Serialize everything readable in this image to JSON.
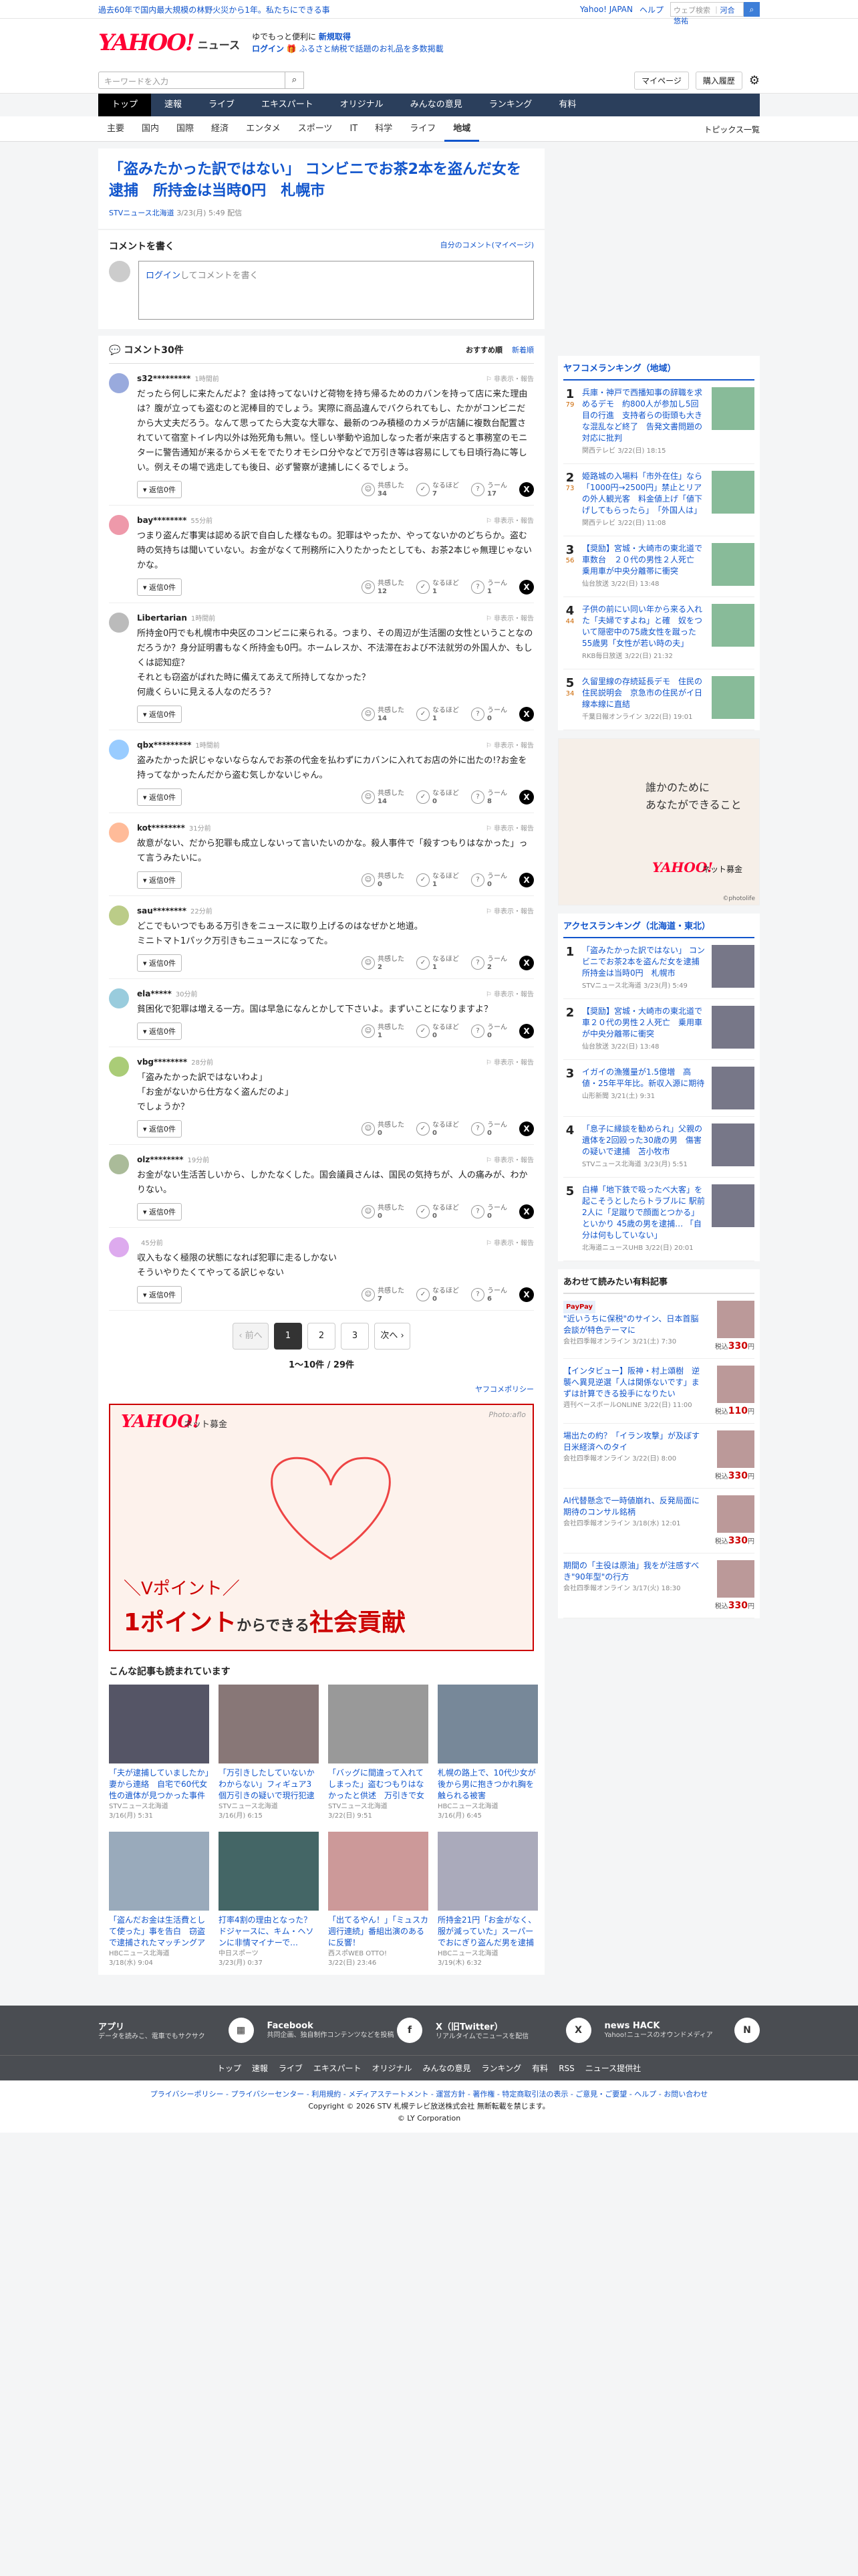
{
  "top": {
    "notice": "過去60年で国内最大規模の林野火災から1年。私たちにできる事",
    "links": [
      "Yahoo! JAPAN",
      "ヘルプ"
    ],
    "search_ph": "ウェブ検索",
    "search_tag": "河合悠祐"
  },
  "header": {
    "brand": "YAHOO!",
    "brand_sub": "JAPAN",
    "service": "ニュース",
    "promo1": "ゆでもっと便利に",
    "promo1b": "新規取得",
    "promo2": "ログイン",
    "promo2b": "ふるさと納税で話題のお礼品を多数掲載"
  },
  "subbar": {
    "search_ph": "キーワードを入力",
    "mypage": "マイページ",
    "purchase": "購入履歴"
  },
  "gnav": [
    "トップ",
    "速報",
    "ライブ",
    "エキスパート",
    "オリジナル",
    "みんなの意見",
    "ランキング",
    "有料"
  ],
  "cnav": [
    "主要",
    "国内",
    "国際",
    "経済",
    "エンタメ",
    "スポーツ",
    "IT",
    "科学",
    "ライフ",
    "地域"
  ],
  "cnav_right": "トピックス一覧",
  "article": {
    "title": "「盗みたかった訳ではない」 コンビニでお茶2本を盗んだ女を逮捕　所持金は当時0円　札幌市",
    "source": "STVニュース北海道",
    "date": "3/23(月) 5:49 配信"
  },
  "write": {
    "title": "コメントを書く",
    "mine": "自分のコメント(マイページ)",
    "login": "ログイン",
    "ph": "してコメントを書く"
  },
  "comments_head": {
    "count": "コメント30件",
    "sort1": "おすすめ順",
    "sort2": "新着順"
  },
  "labels": {
    "reply": "返信0件",
    "report": "非表示・報告",
    "v1": "共感した",
    "v2": "なるほど",
    "v3": "うーん"
  },
  "comments": [
    {
      "name": "s32*********",
      "time": "1時間前",
      "text": "だったら何しに来たんだよ？金は持ってないけど荷物を持ち帰るためのカバンを持って店に来た理由は？腹が立っても盗むのと泥棒目的でしょう。実際に商品違んでバクられてもし、たかがコンビニだから大丈夫だろう。なんて思ってたら大変な大罪な、最新のつみ積極のカメラが店舗に複数台配置されていて宿室トイレ内以外は殆死角も無い。怪しい挙動や追加しなった者が来店すると事務室のモニターに警告通知が来るからメモをでたりオモシロ分やなどで万引き等は容易にしても日頃行為に等しい。例えその場で逃走しても後日、必ず警察が逮捕しにくるでしょう。",
      "v": [
        "34",
        "7",
        "17"
      ],
      "c": "#9ad"
    },
    {
      "name": "bay********",
      "time": "55分前",
      "text": "つまり盗んだ事実は認める訳で自白した様なもの。犯罪はやったか、やってないかのどちらか。盗む時の気持ちは聞いていない。お金がなくて刑務所に入りたかったとしても、お茶2本じゃ無理じゃないかな。",
      "v": [
        "12",
        "1",
        "1"
      ],
      "c": "#e9a"
    },
    {
      "name": "Libertarian",
      "time": "1時間前",
      "text": "所持金0円でも札幌市中央区のコンビニに来られる。つまり、その周辺が生活圏の女性ということなのだろうか？身分証明書もなく所持金も0円。ホームレスか、不法滞在および不法就労の外国人か、もしくは認知症？\nそれとも窃盗がばれた時に備えてあえて所持してなかった？\n何歳くらいに見える人なのだろう？",
      "v": [
        "14",
        "1",
        "0"
      ],
      "c": "#bbb"
    },
    {
      "name": "qbx*********",
      "time": "1時間前",
      "text": "盗みたかった訳じゃないならなんでお茶の代金を払わずにカバンに入れてお店の外に出たの!?お金を持ってなかったんだから盗む気しかないじゃん。",
      "v": [
        "14",
        "0",
        "8"
      ],
      "c": "#9cf"
    },
    {
      "name": "kot********",
      "time": "31分前",
      "text": "故意がない、だから犯罪も成立しないって言いたいのかな。殺人事件で「殺すつもりはなかった」って言うみたいに。",
      "v": [
        "0",
        "1",
        "0"
      ],
      "c": "#fb9"
    },
    {
      "name": "sau********",
      "time": "22分前",
      "text": "どこでもいつでもある万引きをニュースに取り上げるのはなぜかと地道。\nミニトマト1パック万引きもニュースになってた。",
      "v": [
        "2",
        "1",
        "2"
      ],
      "c": "#bc8"
    },
    {
      "name": "ela*****",
      "time": "30分前",
      "text": "貧困化で犯罪は増える一方。国は早急になんとかして下さいよ。まずいことになりますよ？",
      "v": [
        "1",
        "0",
        "0"
      ],
      "c": "#9cd"
    },
    {
      "name": "vbg********",
      "time": "28分前",
      "text": "「盗みたかった訳ではないわよ」\n「お金がないから仕方なく盗んだのよ」\nでしょうか？",
      "v": [
        "0",
        "0",
        "0"
      ],
      "c": "#ac7"
    },
    {
      "name": "olz********",
      "time": "19分前",
      "text": "お金がない生活苦しいから、しかたなくした。国会議員さんは、国民の気持ちが、人の痛みが、わかりない。",
      "v": [
        "0",
        "0",
        "0"
      ],
      "c": "#ab9"
    },
    {
      "name": "",
      "time": "45分前",
      "text": "収入もなく極限の状態になれば犯罪に走るしかない\nそういやりたくてやってる訳じゃない",
      "v": [
        "7",
        "0",
        "6"
      ],
      "c": "#dae"
    }
  ],
  "pager": {
    "prev": "前へ",
    "pages": [
      "1",
      "2",
      "3"
    ],
    "next": "次へ",
    "count": "1〜10件 / 29件"
  },
  "policy": "ヤフコメポリシー",
  "ad_main": {
    "brand": "YAHOO!",
    "brand2": "ネット募金",
    "photo": "Photo:aflo",
    "t1": "＼Vポイント／",
    "t2a": "1ポイント",
    "t2b": "からできる",
    "t2c": "社会貢献"
  },
  "related_title": "こんな記事も読まれています",
  "related": [
    {
      "t": "「夫が逮捕していましたか」妻から連絡　自宅で60代女性の遺体が見つかった事件",
      "s": "STVニュース北海道",
      "d": "3/16(月) 5:31",
      "c": "#556"
    },
    {
      "t": "「万引きしたしていないかわからない」フィギュア3個万引きの疑いで現行犯逮捕",
      "s": "STVニュース北海道",
      "d": "3/16(月) 6:15",
      "c": "#877"
    },
    {
      "t": "「バッグに間違って入れてしまった」盗むつもりはなかったと供述　万引きで女逮捕",
      "s": "STVニュース北海道",
      "d": "3/22(日) 9:51",
      "c": "#999"
    },
    {
      "t": "札幌の路上で、10代少女が後から男に抱きつかれ胸を触られる被害",
      "s": "HBCニュース北海道",
      "d": "3/16(月) 6:45",
      "c": "#789"
    },
    {
      "t": "「盗んだお金は生活費として使った」事を告白　窃盗で逮捕されたマッチングアプリの男",
      "s": "HBCニュース北海道",
      "d": "3/18(水) 9:04",
      "c": "#9ab"
    },
    {
      "t": "打率4割の理由となった？ドジャースに、キム・ヘソンに非情マイナーで…",
      "s": "中日スポーツ",
      "d": "3/23(月) 0:37",
      "c": "#466"
    },
    {
      "t": "「出てるやん！」「ミュスカ週行連続」番組出演のあるに反響！",
      "s": "西スポWEB OTTO!",
      "d": "3/22(日) 23:46",
      "c": "#c99"
    },
    {
      "t": "所持金21円「お金がなく、服が減っていた」スーパーでおにぎり盗んだ男を逮捕",
      "s": "HBCニュース北海道",
      "d": "3/19(木) 6:32",
      "c": "#aab"
    }
  ],
  "side": {
    "rank_title": "ヤフコメランキング（地域）",
    "rank": [
      {
        "n": "1",
        "c": "79",
        "t": "兵庫・神戸で西播知事の辞職を求めるデモ　約800人が参加し5回目の行進　支持者らの街頭も大きな混乱など終了　告発文書問題の対応に批判",
        "s": "関西テレビ",
        "d": "3/22(日) 18:15"
      },
      {
        "n": "2",
        "c": "73",
        "t": "姫路城の入場料「市外在住」なら「1000円→2500円」禁止とリアの外人観光客　料金値上げ「値下げしてもらったら」　「外国人は」",
        "s": "関西テレビ",
        "d": "3/22(日) 11:08"
      },
      {
        "n": "3",
        "c": "56",
        "t": "【奨励】宮城・大崎市の東北道で車数台　２０代の男性２人死亡　乗用車が中央分離帯に衝突",
        "s": "仙台放送",
        "d": "3/22(日) 13:48"
      },
      {
        "n": "4",
        "c": "44",
        "t": "子供の前にい同い年から来る入れた「夫婦ですよね」と確　奴をついて隠密中の75歳女性を蹴った55歳男「女性が若い時の夫」",
        "s": "RKB毎日放送",
        "d": "3/22(日) 21:32"
      },
      {
        "n": "5",
        "c": "34",
        "t": "久留里線の存続延長デモ　住民の住民説明会　京急市の住民がイ日線本線に直結",
        "s": "千葉日報オンライン",
        "d": "3/22(日) 19:01"
      }
    ],
    "ad": {
      "t1": "誰かのために",
      "t2": "あなたができること",
      "brand": "YAHOO!",
      "brand2": "ネット募金",
      "photo": "©photolife"
    },
    "acc_title": "アクセスランキング（北海道・東北）",
    "acc": [
      {
        "n": "1",
        "t": "「盗みたかった訳ではない」 コンビニでお茶2本を盗んだ女を逮捕　所持金は当時0円　札幌市",
        "s": "STVニュース北海道",
        "d": "3/23(月) 5:49"
      },
      {
        "n": "2",
        "t": "【奨励】宮城・大崎市の東北道で車２０代の男性２人死亡　乗用車が中央分離帯に衝突",
        "s": "仙台放送",
        "d": "3/22(日) 13:48"
      },
      {
        "n": "3",
        "t": "イガイの漁獲量が1.5億増　高値・25年平年比。新収入源に期待",
        "s": "山形新聞",
        "d": "3/21(土) 9:31"
      },
      {
        "n": "4",
        "t": "「息子に縁談を勧められ」父親の遺体を2回殴った30歳の男　傷害の疑いで逮捕　苫小牧市",
        "s": "STVニュース北海道",
        "d": "3/23(月) 5:51"
      },
      {
        "n": "5",
        "t": "白樺「地下鉄で吸ったべ大客」を起こそうとしたらトラブルに 駅前2人に「足蹴りで顔面とつかる」といかり 45歳の男を逮捕… 「自分は何もしていない」",
        "s": "北海道ニュースUHB",
        "d": "3/22(日) 20:01"
      }
    ],
    "feat_title": "あわせて読みたい有料記事",
    "feat": [
      {
        "t": "\"近いうちに保税\"のサイン、日本首脳会談が特色テーマに",
        "s": "会社四季報オンライン",
        "d": "3/21(土) 7:30",
        "p": "330",
        "pp": true
      },
      {
        "t": "【インタビュー】阪神・村上頌樹　逆襲へ異見逆選「人は関係ないです」まずは計算できる投手になりたい",
        "s": "週刊ベースボールONLINE",
        "d": "3/22(日) 11:00",
        "p": "110"
      },
      {
        "t": "場出たの約？「イラン攻撃」が及ぼす日米経済へのタイ",
        "s": "会社四季報オンライン",
        "d": "3/22(日) 8:00",
        "p": "330"
      },
      {
        "t": "AI代替懸念で一時値崩れ、反発局面に期待のコンサル銘柄",
        "s": "会社四季報オンライン",
        "d": "3/18(水) 12:01",
        "p": "330"
      },
      {
        "t": "期間の「主役は原油」我をが注感すべき\"90年型\"の行方",
        "s": "会社四季報オンライン",
        "d": "3/17(火) 18:30",
        "p": "330"
      }
    ],
    "price_pre": "税込"
  },
  "footer": {
    "blocks": [
      {
        "t": "アプリ",
        "d": "データを読みこ、電車でもサクサク"
      },
      {
        "t": "Facebook",
        "d": "共同企画、独自制作コンテンツなどを投稿"
      },
      {
        "t": "X（旧Twitter）",
        "d": "リアルタイムでニュースを配信"
      },
      {
        "t": "news HACK",
        "d": "Yahoo!ニュースのオウンドメディア"
      }
    ],
    "links": [
      "トップ",
      "速報",
      "ライブ",
      "エキスパート",
      "オリジナル",
      "みんなの意見",
      "ランキング",
      "有料",
      "RSS",
      "ニュース提供社"
    ],
    "legal": "プライバシーポリシー - プライバシーセンター - 利用規約 - メディアステートメント - 運営方針 - 著作権 - 特定商取引法の表示 - ご意見・ご要望 - ヘルプ - お問い合わせ",
    "copy": "Copyright © 2026 STV 札幌テレビ放送株式会社 無断転載を禁じます。",
    "copy2": "© LY Corporation"
  }
}
